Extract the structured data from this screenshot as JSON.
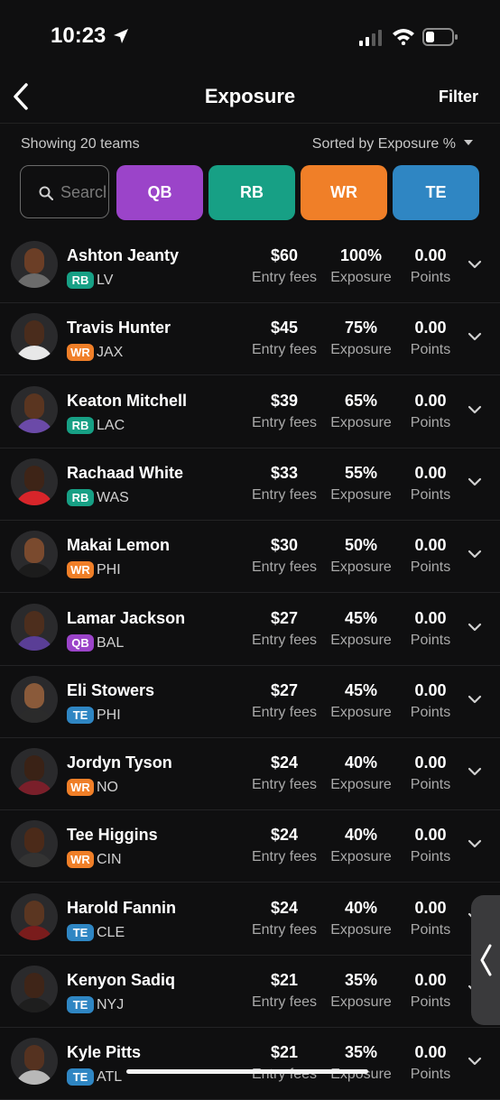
{
  "status": {
    "time": "10:23"
  },
  "header": {
    "title": "Exposure",
    "filter_label": "Filter"
  },
  "summary": {
    "showing": "Showing 20 teams",
    "sorted": "Sorted by Exposure %"
  },
  "search": {
    "placeholder": "Search"
  },
  "chips": [
    {
      "label": "QB",
      "color": "#9b44c9"
    },
    {
      "label": "RB",
      "color": "#17a085"
    },
    {
      "label": "WR",
      "color": "#f07f28"
    },
    {
      "label": "TE",
      "color": "#2f86c3"
    }
  ],
  "labels": {
    "entry": "Entry fees",
    "exposure": "Exposure",
    "points": "Points"
  },
  "players": [
    {
      "name": "Ashton Jeanty",
      "pos": "RB",
      "team": "LV",
      "fees": "$60",
      "exposure": "100%",
      "points": "0.00"
    },
    {
      "name": "Travis Hunter",
      "pos": "WR",
      "team": "JAX",
      "fees": "$45",
      "exposure": "75%",
      "points": "0.00"
    },
    {
      "name": "Keaton Mitchell",
      "pos": "RB",
      "team": "LAC",
      "fees": "$39",
      "exposure": "65%",
      "points": "0.00"
    },
    {
      "name": "Rachaad White",
      "pos": "RB",
      "team": "WAS",
      "fees": "$33",
      "exposure": "55%",
      "points": "0.00"
    },
    {
      "name": "Makai Lemon",
      "pos": "WR",
      "team": "PHI",
      "fees": "$30",
      "exposure": "50%",
      "points": "0.00"
    },
    {
      "name": "Lamar Jackson",
      "pos": "QB",
      "team": "BAL",
      "fees": "$27",
      "exposure": "45%",
      "points": "0.00"
    },
    {
      "name": "Eli Stowers",
      "pos": "TE",
      "team": "PHI",
      "fees": "$27",
      "exposure": "45%",
      "points": "0.00"
    },
    {
      "name": "Jordyn Tyson",
      "pos": "WR",
      "team": "NO",
      "fees": "$24",
      "exposure": "40%",
      "points": "0.00"
    },
    {
      "name": "Tee Higgins",
      "pos": "WR",
      "team": "CIN",
      "fees": "$24",
      "exposure": "40%",
      "points": "0.00"
    },
    {
      "name": "Harold Fannin",
      "pos": "TE",
      "team": "CLE",
      "fees": "$24",
      "exposure": "40%",
      "points": "0.00"
    },
    {
      "name": "Kenyon Sadiq",
      "pos": "TE",
      "team": "NYJ",
      "fees": "$21",
      "exposure": "35%",
      "points": "0.00"
    },
    {
      "name": "Kyle Pitts",
      "pos": "TE",
      "team": "ATL",
      "fees": "$21",
      "exposure": "35%",
      "points": "0.00"
    }
  ]
}
